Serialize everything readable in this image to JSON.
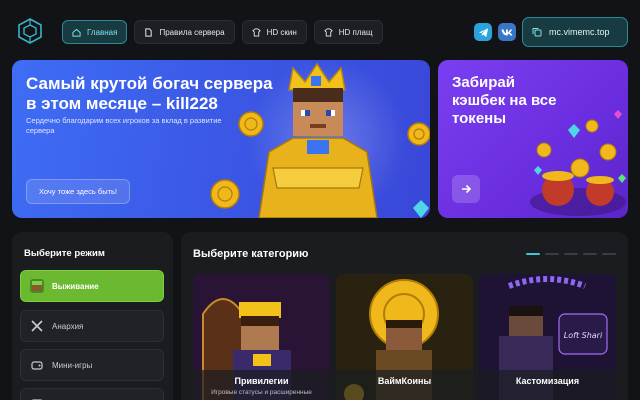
{
  "nav": {
    "items": [
      {
        "label": "Главная",
        "icon": "home-icon",
        "active": true
      },
      {
        "label": "Правила сервера",
        "icon": "document-icon",
        "active": false
      },
      {
        "label": "HD скин",
        "icon": "shirt-icon",
        "active": false
      },
      {
        "label": "HD плащ",
        "icon": "shirt-icon",
        "active": false
      }
    ]
  },
  "social": {
    "telegram_icon": "telegram-icon",
    "vk_icon": "vk-icon"
  },
  "server": {
    "ip": "mc.vimemc.top",
    "icon": "copy-icon"
  },
  "hero": {
    "title": "Самый крутой богач сервера в этом месяце – kill228",
    "subtitle": "Сердечно благодарим всех игроков за вклад в развитие сервера",
    "button": "Хочу тоже здесь быть!"
  },
  "cashback": {
    "title": "Забирай кэшбек на все токены",
    "button_icon": "arrow-right-icon"
  },
  "modes": {
    "title": "Выберите режим",
    "items": [
      {
        "label": "Выживание",
        "active": true
      },
      {
        "label": "Анархия",
        "active": false
      },
      {
        "label": "Мини-игры",
        "active": false
      }
    ]
  },
  "categories": {
    "title": "Выберите категорию",
    "items": [
      {
        "title": "Привилегии",
        "subtitle": "Игровые статусы и расширенные"
      },
      {
        "title": "ВаймКоины",
        "subtitle": ""
      },
      {
        "title": "Кастомизация",
        "subtitle": ""
      }
    ],
    "sign_text": "Loft Shari"
  },
  "colors": {
    "accent": "#41c4d8",
    "hero_bg": "#3b5ae6",
    "cashback_bg": "#6a2ee0",
    "mode_active": "#6ab931"
  }
}
